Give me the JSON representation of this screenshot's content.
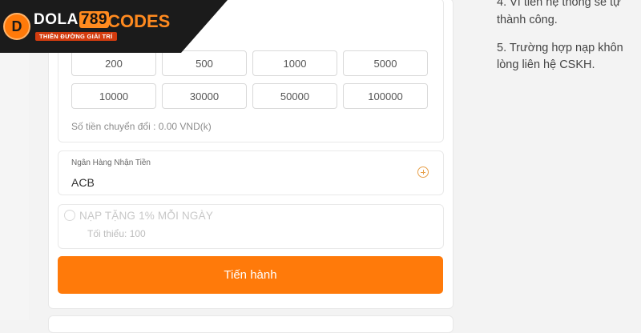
{
  "logo": {
    "letter": "D",
    "main": "DOLA",
    "highlight": "789",
    "suffix": ".CODES",
    "tagline": "THIÊN ĐƯỜNG GIẢI TRÍ"
  },
  "amounts": {
    "options": [
      "200",
      "500",
      "1000",
      "5000",
      "10000",
      "30000",
      "50000",
      "100000"
    ],
    "converted_text": "Số tiền chuyển đổi : 0.00 VND(k)"
  },
  "bank": {
    "label": "Ngân Hàng Nhận Tiền",
    "value": "ACB"
  },
  "promo": {
    "title": "NẠP TẶNG 1% MỖI NGÀY",
    "subtitle": "Tối thiểu: 100"
  },
  "submit_label": "Tiến hành",
  "notes": {
    "line1": "4. Vì tiền hệ thống sẽ tự",
    "line2": "thành công.",
    "line3": "5. Trường hợp nạp khôn",
    "line4": "lòng liên hệ CSKH."
  },
  "colors": {
    "accent": "#ff7a0a",
    "plus": "#e8a04a"
  }
}
